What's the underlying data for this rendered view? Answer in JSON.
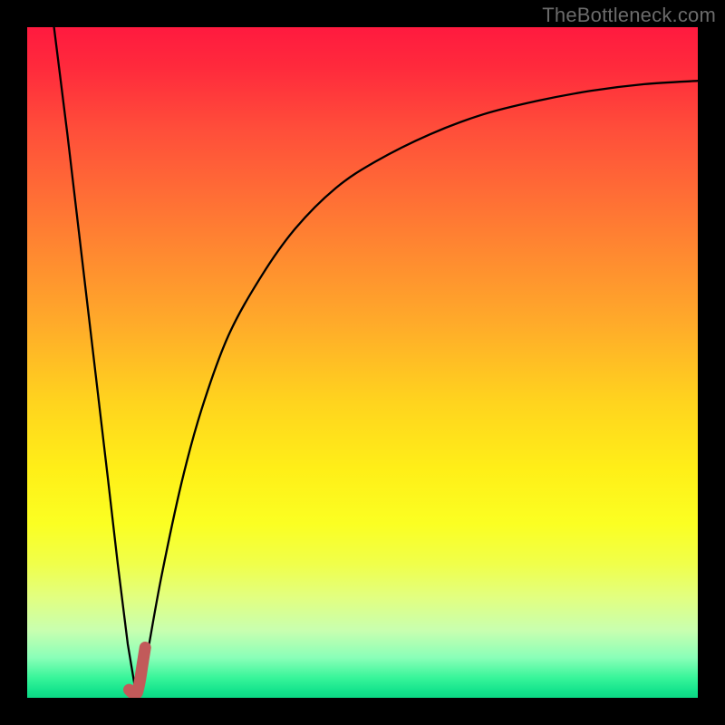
{
  "watermark": "TheBottleneck.com",
  "chart_data": {
    "type": "line",
    "title": "",
    "xlabel": "",
    "ylabel": "",
    "xlim": [
      0,
      100
    ],
    "ylim": [
      0,
      100
    ],
    "grid": false,
    "series": [
      {
        "name": "left-branch",
        "x": [
          4,
          6,
          8,
          10,
          12,
          13.5,
          15,
          16
        ],
        "y": [
          100,
          84,
          67,
          50,
          33,
          20,
          8,
          2
        ],
        "stroke": "#000000",
        "width": 2.3
      },
      {
        "name": "right-branch",
        "x": [
          17,
          18,
          20,
          23,
          26,
          30,
          35,
          40,
          46,
          52,
          60,
          68,
          76,
          84,
          92,
          100
        ],
        "y": [
          2,
          7,
          18,
          32,
          43,
          54,
          63,
          70,
          76,
          80,
          84,
          87,
          89,
          90.5,
          91.5,
          92
        ],
        "stroke": "#000000",
        "width": 2.3
      },
      {
        "name": "marker-j",
        "x": [
          15.2,
          15.6,
          16.0,
          16.4,
          16.8,
          17.2,
          17.6
        ],
        "y": [
          1.2,
          0.8,
          0.7,
          0.8,
          2.5,
          5.0,
          7.5
        ],
        "stroke": "#c25a5a",
        "width": 13
      }
    ]
  }
}
